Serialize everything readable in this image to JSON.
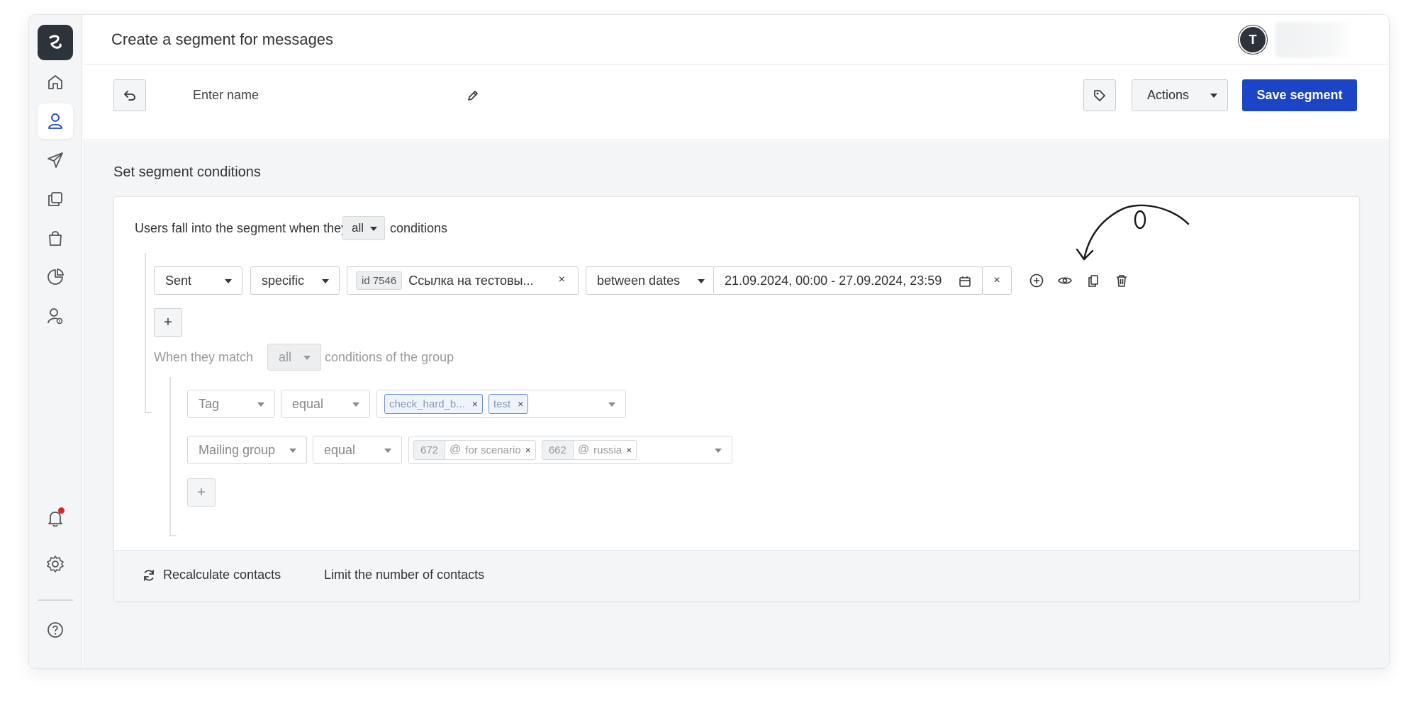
{
  "header": {
    "title": "Create a segment for messages",
    "avatar_initial": "T"
  },
  "toolbar": {
    "name_placeholder": "Enter name",
    "actions_label": "Actions",
    "save_label": "Save segment"
  },
  "section": {
    "title": "Set segment conditions"
  },
  "match_rule": {
    "prefix": "Users fall into the segment when they match",
    "mode": "all",
    "suffix": "conditions"
  },
  "condition": {
    "field": "Sent",
    "type": "specific",
    "message_id": "id 7546",
    "message_name": "Ссылка на тестовы...",
    "date_operator": "between dates",
    "date_range": "21.09.2024, 00:00 - 27.09.2024, 23:59"
  },
  "add_button_label": "+",
  "group": {
    "prefix": "When they match",
    "mode": "all",
    "suffix": "conditions of the group",
    "rows": [
      {
        "field": "Tag",
        "operator": "equal",
        "tags": [
          "check_hard_b...",
          "test"
        ]
      },
      {
        "field": "Mailing group",
        "operator": "equal",
        "groups": [
          {
            "id": "672",
            "name": "for scenario"
          },
          {
            "id": "662",
            "name": "russia"
          }
        ]
      }
    ],
    "add_button_label": "+"
  },
  "footer": {
    "recalculate_label": "Recalculate contacts",
    "limit_label": "Limit the number of contacts"
  },
  "colors": {
    "primary": "#1b45c6",
    "sidebar_bg": "#f4f5f7",
    "active_nav_icon": "#1b45c6",
    "notification_dot": "#e02424"
  }
}
